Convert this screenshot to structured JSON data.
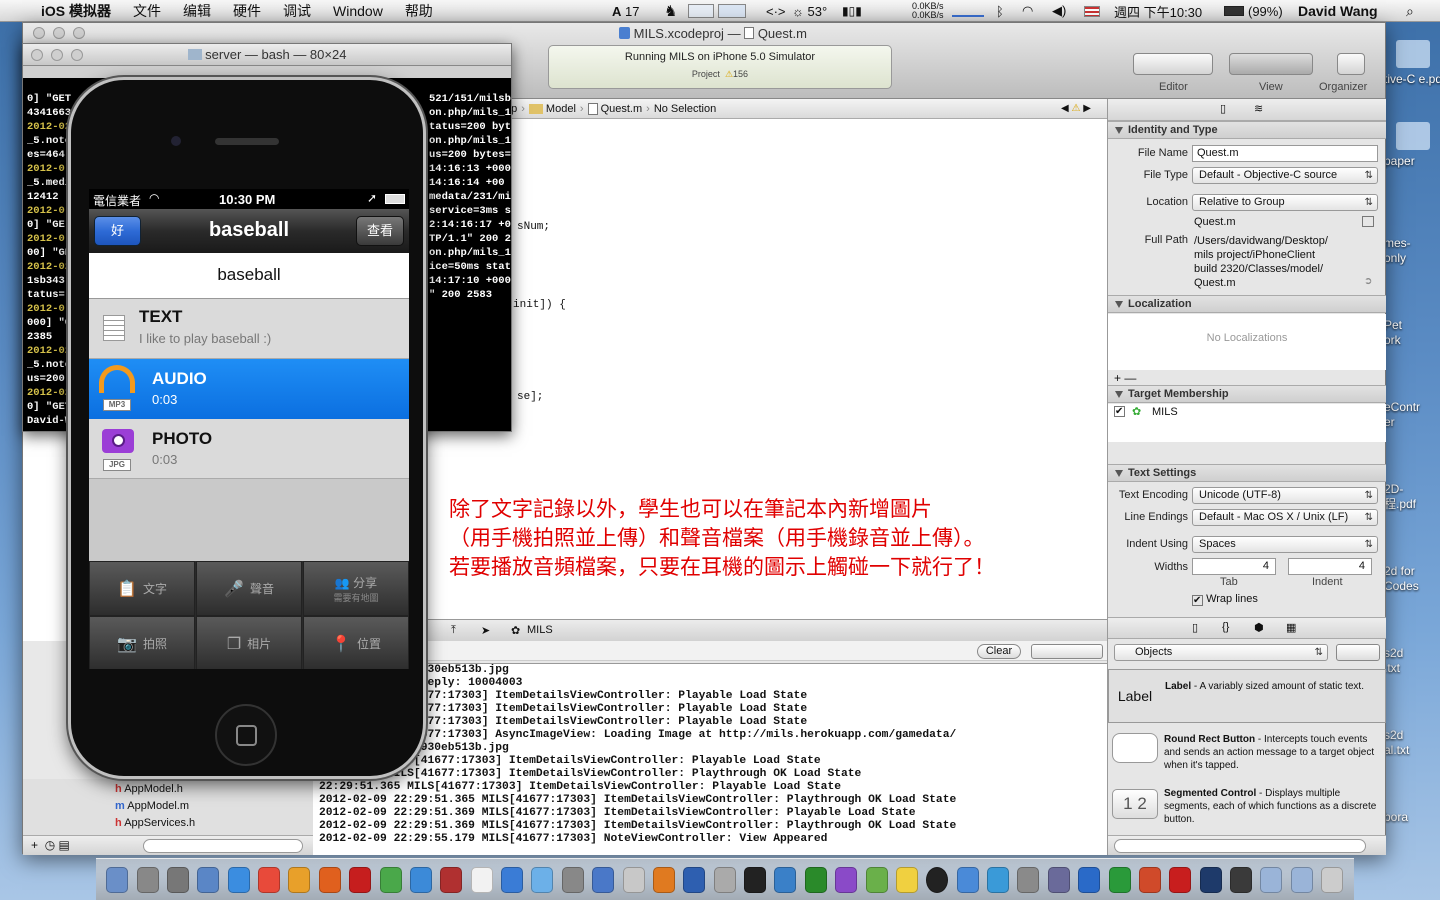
{
  "menubar": {
    "app": "iOS 模拟器",
    "items": [
      "文件",
      "编辑",
      "硬件",
      "调试",
      "Window",
      "帮助"
    ],
    "status_temp": "53°",
    "status_count": "17",
    "net_up": "0.0KB/s",
    "net_down": "0.0KB/s",
    "clock": "週四 下午10:30",
    "battery": "(99%)",
    "user": "David Wang"
  },
  "desktop": {
    "items": [
      "tive-C\ne.pdf",
      "paper",
      "mes-\nonly",
      "Pet\nork",
      "eContr\ner",
      "2D-\n程.pdf",
      "2d for\nCodes",
      "s2d\n.txt",
      "s2d\nal.txt",
      "bora"
    ]
  },
  "terminal": {
    "title": "server — bash — 80×24",
    "left_lines": [
      "0] \"GET",
      "4341663",
      "2012-02",
      "_5.note",
      "es=464",
      "2012-0",
      "_5.medi",
      "12412",
      "2012-0",
      "0] \"GE",
      "2012-0",
      "00] \"GE",
      "2012-02",
      "1sb343",
      "tatus=",
      "2012-0",
      "000] \"G",
      "2385",
      "2012-02",
      "_5.note",
      "us=200",
      "2012-02",
      "0] \"GET",
      "David-W"
    ],
    "right_lines": [
      "521/151/milsb3",
      "on.php/mils_1",
      "tatus=200 byt",
      "",
      "on.php/mils_1",
      "us=200 bytes=",
      "",
      "14:16:13 +000",
      "",
      "14:16:14 +00",
      "",
      "medata/231/mi",
      "service=3ms s",
      "",
      "2:14:16:17 +0",
      "TP/1.1\" 200 2",
      "",
      "on.php/mils_1",
      "ice=50ms stat",
      "",
      "14:17:10 +000",
      "\" 200 2583"
    ]
  },
  "xcode": {
    "title": "MILS.xcodeproj",
    "title_file": "Quest.m",
    "status_main": "Running MILS on iPhone 5.0 Simulator",
    "status_project": "Project",
    "status_warnings": "156",
    "toolbar_labels": {
      "editor": "Editor",
      "view": "View",
      "organizer": "Organizer"
    },
    "jumpbar": [
      "pp",
      "Model",
      "Quest.m",
      "No Selection"
    ],
    "code_fragments": [
      "sNum;",
      "init]) {",
      "se];"
    ],
    "annotation": [
      "除了文字記錄以外，學生也可以在筆記本內新增圖片",
      "（用手機拍照並上傳）和聲音檔案（用手機錄音並上傳）。",
      "若要播放音頻檔案，只要在耳機的圖示上觸碰一下就行了！"
    ],
    "debug_bar_target": "MILS",
    "clear_label": "Clear",
    "log": [
      "38781cd42825fb4930eb513b.jpg",
      "led to receive reply: 10004003",
      ":50.322 MILS[41677:17303] ItemDetailsViewController: Playable Load State",
      ":50.322 MILS[41677:17303] ItemDetailsViewController: Playable Load State",
      ":50.325 MILS[41677:17303] ItemDetailsViewController: Playable Load State",
      ":50.326 MILS[41677:17303] AsyncImageView: Loading Image at http://mils.herokuapp.com/gamedata/",
      "38781cd42825fb4930eb513b.jpg",
      "29:51.364 MILS[41677:17303] ItemDetailsViewController: Playable Load State",
      "29:51.364 MILS[41677:17303] ItemDetailsViewController: Playthrough OK Load State",
      "22:29:51.365 MILS[41677:17303] ItemDetailsViewController: Playable Load State",
      "2012-02-09 22:29:51.365 MILS[41677:17303] ItemDetailsViewController: Playthrough OK Load State",
      "2012-02-09 22:29:51.369 MILS[41677:17303] ItemDetailsViewController: Playable Load State",
      "2012-02-09 22:29:51.369 MILS[41677:17303] ItemDetailsViewController: Playthrough OK Load State",
      "2012-02-09 22:29:55.179 MILS[41677:17303] NoteViewController: View Appeared"
    ],
    "navigator_files": [
      "AppModel.h",
      "AppModel.m",
      "AppServices.h"
    ],
    "inspector": {
      "identity_title": "Identity and Type",
      "file_name_label": "File Name",
      "file_name": "Quest.m",
      "file_type_label": "File Type",
      "file_type": "Default - Objective-C source",
      "location_label": "Location",
      "location": "Relative to Group",
      "location_file": "Quest.m",
      "full_path_label": "Full Path",
      "full_path": "/Users/davidwang/Desktop/\nmils project/iPhoneClient\nbuild 2320/Classes/model/\nQuest.m",
      "localization_title": "Localization",
      "no_localizations": "No Localizations",
      "target_title": "Target Membership",
      "target": "MILS",
      "text_settings_title": "Text Settings",
      "encoding_label": "Text Encoding",
      "encoding": "Unicode (UTF-8)",
      "line_endings_label": "Line Endings",
      "line_endings": "Default - Mac OS X / Unix (LF)",
      "indent_using_label": "Indent Using",
      "indent_using": "Spaces",
      "widths_label": "Widths",
      "tab_width": "4",
      "indent_width": "4",
      "tab_label": "Tab",
      "indent_label": "Indent",
      "wrap_lines": "Wrap lines",
      "library_selector": "Objects",
      "library": [
        {
          "icon": "Label",
          "name": "Label",
          "desc": " - A variably sized amount of static text."
        },
        {
          "icon": "",
          "name": "Round Rect Button",
          "desc": " - Intercepts touch events and sends an action message to a target object when it's tapped."
        },
        {
          "icon": "1 2",
          "name": "Segmented Control",
          "desc": " - Displays multiple segments, each of which functions as a discrete button."
        }
      ]
    }
  },
  "iphone": {
    "carrier": "電信業者",
    "time": "10:30 PM",
    "nav_title": "baseball",
    "nav_left": "好",
    "nav_right": "查看",
    "header": "baseball",
    "items": [
      {
        "title": "TEXT",
        "subtitle": "I like to play baseball :)",
        "icon": "note-icon",
        "tag": ""
      },
      {
        "title": "AUDIO",
        "subtitle": "0:03",
        "icon": "headphones-icon",
        "tag": "MP3"
      },
      {
        "title": "PHOTO",
        "subtitle": "0:03",
        "icon": "camera-icon",
        "tag": "JPG"
      }
    ],
    "toolbar": [
      {
        "label": "文字",
        "icon": "clipboard-icon"
      },
      {
        "label": "聲音",
        "icon": "microphone-icon"
      },
      {
        "label": "分享",
        "sub": "需要有地圖",
        "icon": "people-icon"
      },
      {
        "label": "拍照",
        "icon": "camera-icon"
      },
      {
        "label": "相片",
        "icon": "photos-icon"
      },
      {
        "label": "位置",
        "icon": "pin-icon"
      }
    ]
  },
  "colors": {
    "selection_blue": "#1a7ef0",
    "annotation_red": "#e00000",
    "nav_button_blue": "#2e6bd6"
  }
}
